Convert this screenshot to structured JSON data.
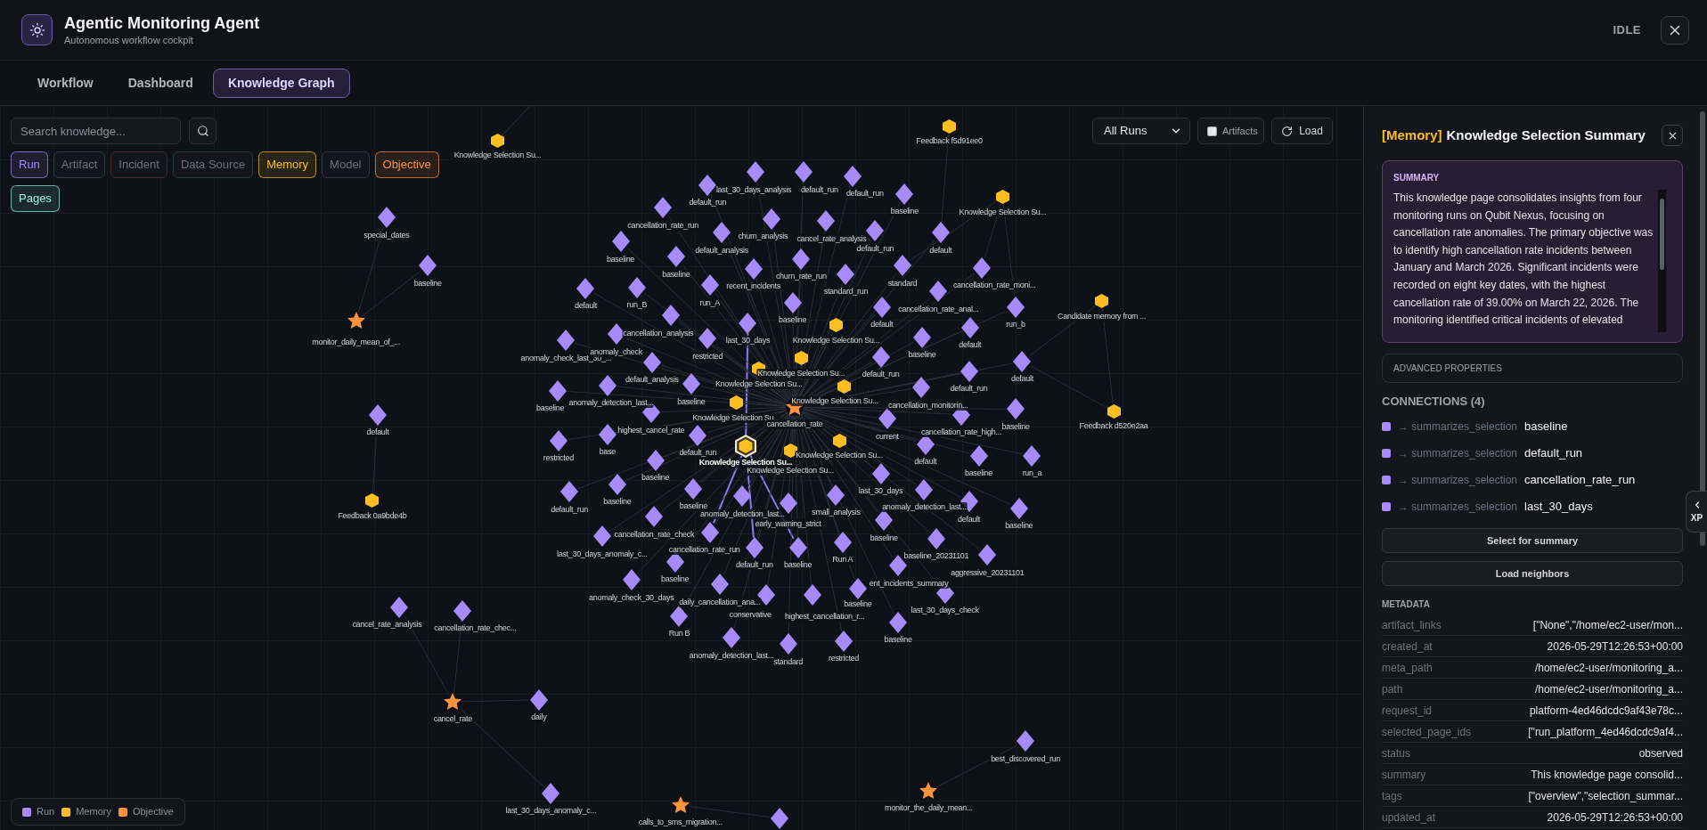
{
  "header": {
    "title": "Agentic Monitoring Agent",
    "subtitle": "Autonomous workflow cockpit",
    "status": "IDLE"
  },
  "tabs": [
    {
      "label": "Workflow",
      "selected": false
    },
    {
      "label": "Dashboard",
      "selected": false
    },
    {
      "label": "Knowledge Graph",
      "selected": true
    }
  ],
  "search": {
    "placeholder": "Search knowledge..."
  },
  "filters": [
    {
      "label": "Run",
      "active": true,
      "color": "#a78bfa"
    },
    {
      "label": "Artifact",
      "active": false,
      "color": "#343b48"
    },
    {
      "label": "Incident",
      "active": false,
      "color": "#4a2b32"
    },
    {
      "label": "Data Source",
      "active": false,
      "color": "#24403d"
    },
    {
      "label": "Memory",
      "active": true,
      "color": "#fbbf24"
    },
    {
      "label": "Model",
      "active": false,
      "color": "#363244"
    },
    {
      "label": "Objective",
      "active": true,
      "color": "#fb923c"
    },
    {
      "label": "Pages",
      "active": true,
      "color": "#99f6e4"
    }
  ],
  "graph_controls": {
    "run_filter": "All Runs",
    "artifacts": {
      "label": "Artifacts",
      "checked": false
    },
    "load": "Load"
  },
  "nodes": [
    {
      "label": "Feedback f5d91ee0",
      "kind": "memory",
      "selected": false
    },
    {
      "label": "Knowledge Selection Su...",
      "kind": "memory",
      "selected": false
    },
    {
      "label": "last_30_days_analysis",
      "kind": "run",
      "selected": false
    },
    {
      "label": "default_run",
      "kind": "run",
      "selected": false
    },
    {
      "label": "default_run",
      "kind": "run",
      "selected": false
    },
    {
      "label": "default_run",
      "kind": "run",
      "selected": false
    },
    {
      "label": "baseline",
      "kind": "run",
      "selected": false
    },
    {
      "label": "Knowledge Selection Su...",
      "kind": "memory",
      "selected": false
    },
    {
      "label": "cancellation_rate_run",
      "kind": "run",
      "selected": false
    },
    {
      "label": "special_dates",
      "kind": "run",
      "selected": false
    },
    {
      "label": "churn_analysis",
      "kind": "run",
      "selected": false
    },
    {
      "label": "cancel_rate_analysis",
      "kind": "run",
      "selected": false
    },
    {
      "label": "default_analysis",
      "kind": "run",
      "selected": false
    },
    {
      "label": "default_run",
      "kind": "run",
      "selected": false
    },
    {
      "label": "default",
      "kind": "run",
      "selected": false
    },
    {
      "label": "baseline",
      "kind": "run",
      "selected": false
    },
    {
      "label": "baseline",
      "kind": "run",
      "selected": false
    },
    {
      "label": "baseline",
      "kind": "run",
      "selected": false
    },
    {
      "label": "recent_incidents",
      "kind": "run",
      "selected": false
    },
    {
      "label": "churn_rate_run",
      "kind": "run",
      "selected": false
    },
    {
      "label": "standard_run",
      "kind": "run",
      "selected": false
    },
    {
      "label": "standard",
      "kind": "run",
      "selected": false
    },
    {
      "label": "cancellation_rate_moni...",
      "kind": "run",
      "selected": false
    },
    {
      "label": "default",
      "kind": "run",
      "selected": false
    },
    {
      "label": "run_B",
      "kind": "run",
      "selected": false
    },
    {
      "label": "run_A",
      "kind": "run",
      "selected": false
    },
    {
      "label": "cancellation_rate_anal...",
      "kind": "run",
      "selected": false
    },
    {
      "label": "baseline",
      "kind": "run",
      "selected": false
    },
    {
      "label": "default",
      "kind": "run",
      "selected": false
    },
    {
      "label": "run_b",
      "kind": "run",
      "selected": false
    },
    {
      "label": "Candidate memory from ...",
      "kind": "memory",
      "selected": false
    },
    {
      "label": "cancellation_analysis",
      "kind": "run",
      "selected": false
    },
    {
      "label": "monitor_daily_mean_of_...",
      "kind": "objective",
      "selected": false
    },
    {
      "label": "anomaly_check_last_30_...",
      "kind": "run",
      "selected": false
    },
    {
      "label": "anomaly_check",
      "kind": "run",
      "selected": false
    },
    {
      "label": "restricted",
      "kind": "run",
      "selected": false
    },
    {
      "label": "last_30_days",
      "kind": "run",
      "selected": false
    },
    {
      "label": "Knowledge Selection Su...",
      "kind": "memory",
      "selected": false
    },
    {
      "label": "baseline",
      "kind": "run",
      "selected": false
    },
    {
      "label": "default",
      "kind": "run",
      "selected": false
    },
    {
      "label": "default_analysis",
      "kind": "run",
      "selected": false
    },
    {
      "label": "Knowledge Selection Su...",
      "kind": "memory",
      "selected": false
    },
    {
      "label": "Knowledge Selection Su...",
      "kind": "memory",
      "selected": false
    },
    {
      "label": "default_run",
      "kind": "run",
      "selected": false
    },
    {
      "label": "default_run",
      "kind": "run",
      "selected": false
    },
    {
      "label": "default",
      "kind": "run",
      "selected": false
    },
    {
      "label": "baseline",
      "kind": "run",
      "selected": false
    },
    {
      "label": "anomaly_detection_last...",
      "kind": "run",
      "selected": false
    },
    {
      "label": "baseline",
      "kind": "run",
      "selected": false
    },
    {
      "label": "Knowledge Selection Su...",
      "kind": "memory",
      "selected": false
    },
    {
      "label": "cancellation_monitorin...",
      "kind": "run",
      "selected": false
    },
    {
      "label": "default",
      "kind": "run",
      "selected": false
    },
    {
      "label": "highest_cancel_rate",
      "kind": "run",
      "selected": false
    },
    {
      "label": "Knowledge Selection Su...",
      "kind": "memory",
      "selected": false
    },
    {
      "label": "cancellation_rate",
      "kind": "objective",
      "selected": false
    },
    {
      "label": "current",
      "kind": "run",
      "selected": false
    },
    {
      "label": "cancellation_rate_high...",
      "kind": "run",
      "selected": false
    },
    {
      "label": "baseline",
      "kind": "run",
      "selected": false
    },
    {
      "label": "Feedback d520e2aa",
      "kind": "memory",
      "selected": false
    },
    {
      "label": "restricted",
      "kind": "run",
      "selected": false
    },
    {
      "label": "base",
      "kind": "run",
      "selected": false
    },
    {
      "label": "default_run",
      "kind": "run",
      "selected": false
    },
    {
      "label": "Knowledge Selection Su...",
      "kind": "memory",
      "selected": true
    },
    {
      "label": "Knowledge Selection Su...",
      "kind": "memory",
      "selected": false
    },
    {
      "label": "default",
      "kind": "run",
      "selected": false
    },
    {
      "label": "baseline",
      "kind": "run",
      "selected": false
    },
    {
      "label": "Knowledge Selection Su...",
      "kind": "memory",
      "selected": false
    },
    {
      "label": "baseline",
      "kind": "run",
      "selected": false
    },
    {
      "label": "run_a",
      "kind": "run",
      "selected": false
    },
    {
      "label": "last_30_days",
      "kind": "run",
      "selected": false
    },
    {
      "label": "Feedback 0a9bde4b",
      "kind": "memory",
      "selected": false
    },
    {
      "label": "default_run",
      "kind": "run",
      "selected": false
    },
    {
      "label": "baseline",
      "kind": "run",
      "selected": false
    },
    {
      "label": "baseline",
      "kind": "run",
      "selected": false
    },
    {
      "label": "anomaly_detection_last...",
      "kind": "run",
      "selected": false
    },
    {
      "label": "early_warning_strict",
      "kind": "run",
      "selected": false
    },
    {
      "label": "small_analysis",
      "kind": "run",
      "selected": false
    },
    {
      "label": "anomaly_detection_last...",
      "kind": "run",
      "selected": false
    },
    {
      "label": "default",
      "kind": "run",
      "selected": false
    },
    {
      "label": "baseline",
      "kind": "run",
      "selected": false
    },
    {
      "label": "cancellation_rate_check",
      "kind": "run",
      "selected": false
    },
    {
      "label": "baseline",
      "kind": "run",
      "selected": false
    },
    {
      "label": "last_30_days_anomaly_c...",
      "kind": "run",
      "selected": false
    },
    {
      "label": "cancellation_rate_run",
      "kind": "run",
      "selected": false
    },
    {
      "label": "default_run",
      "kind": "run",
      "selected": false
    },
    {
      "label": "baseline",
      "kind": "run",
      "selected": false
    },
    {
      "label": "Run A",
      "kind": "run",
      "selected": false
    },
    {
      "label": "baseline_20231101",
      "kind": "run",
      "selected": false
    },
    {
      "label": "baseline",
      "kind": "run",
      "selected": false
    },
    {
      "label": "ent_incidents_summary",
      "kind": "run",
      "selected": false
    },
    {
      "label": "aggressive_20231101",
      "kind": "run",
      "selected": false
    },
    {
      "label": "anomaly_check_30_days",
      "kind": "run",
      "selected": false
    },
    {
      "label": "daily_cancellation_ana...",
      "kind": "run",
      "selected": false
    },
    {
      "label": "baseline",
      "kind": "run",
      "selected": false
    },
    {
      "label": "conservative",
      "kind": "run",
      "selected": false
    },
    {
      "label": "highest_cancellation_r...",
      "kind": "run",
      "selected": false
    },
    {
      "label": "last_30_days_check",
      "kind": "run",
      "selected": false
    },
    {
      "label": "cancel_rate_analysis",
      "kind": "run",
      "selected": false
    },
    {
      "label": "cancellation_rate_chec...",
      "kind": "run",
      "selected": false
    },
    {
      "label": "Run B",
      "kind": "run",
      "selected": false
    },
    {
      "label": "baseline",
      "kind": "run",
      "selected": false
    },
    {
      "label": "anomaly_detection_last...",
      "kind": "run",
      "selected": false
    },
    {
      "label": "standard",
      "kind": "run",
      "selected": false
    },
    {
      "label": "restricted",
      "kind": "run",
      "selected": false
    },
    {
      "label": "cancel_rate",
      "kind": "objective",
      "selected": false
    },
    {
      "label": "daily",
      "kind": "run",
      "selected": false
    },
    {
      "label": "best_discovered_run",
      "kind": "run",
      "selected": false
    },
    {
      "label": "last_30_days_anomaly_c...",
      "kind": "run",
      "selected": false
    },
    {
      "label": "monitor_the_daily_mean...",
      "kind": "objective",
      "selected": false
    },
    {
      "label": "calls_to_sms_migration...",
      "kind": "objective",
      "selected": false
    },
    {
      "kind": "run",
      "selected": false
    }
  ],
  "legend": [
    {
      "label": "Run",
      "color": "#a78bfa"
    },
    {
      "label": "Memory",
      "color": "#fbbf24"
    },
    {
      "label": "Objective",
      "color": "#fb923c"
    }
  ],
  "detail_panel": {
    "kind_tag": "[Memory]",
    "title": "Knowledge Selection Summary",
    "summary_heading": "SUMMARY",
    "summary": "This knowledge page consolidates insights from four monitoring runs on Qubit Nexus, focusing on cancellation rate anomalies. The primary objective was to identify high cancellation rate incidents between January and March 2026. Significant incidents were recorded on eight key dates, with the highest cancellation rate of 39.00% on March 22, 2026. The monitoring identified critical incidents of elevated",
    "advanced": "ADVANCED PROPERTIES",
    "connections_heading": "CONNECTIONS (4)",
    "connections": [
      {
        "relation": "→ summarizes_selection",
        "target": "baseline",
        "kind": "run"
      },
      {
        "relation": "→ summarizes_selection",
        "target": "default_run",
        "kind": "run"
      },
      {
        "relation": "→ summarizes_selection",
        "target": "cancellation_rate_run",
        "kind": "run"
      },
      {
        "relation": "→ summarizes_selection",
        "target": "last_30_days",
        "kind": "run"
      }
    ],
    "actions": [
      "Select for summary",
      "Load neighbors"
    ],
    "metadata_heading": "METADATA",
    "metadata": [
      {
        "key": "artifact_links",
        "value": "[\"None\",\"/home/ec2-user/mon..."
      },
      {
        "key": "created_at",
        "value": "2026-05-29T12:26:53+00:00"
      },
      {
        "key": "meta_path",
        "value": "/home/ec2-user/monitoring_a..."
      },
      {
        "key": "path",
        "value": "/home/ec2-user/monitoring_a..."
      },
      {
        "key": "request_id",
        "value": "platform-4ed46dcdc9af43e78c..."
      },
      {
        "key": "selected_page_ids",
        "value": "[\"run_platform_4ed46dcdc9af4..."
      },
      {
        "key": "status",
        "value": "observed"
      },
      {
        "key": "summary",
        "value": "This knowledge page consolid..."
      },
      {
        "key": "tags",
        "value": "[\"overview\",\"selection_summar..."
      },
      {
        "key": "updated_at",
        "value": "2026-05-29T12:26:53+00:00"
      }
    ]
  },
  "side_tab": {
    "label": "XP"
  }
}
